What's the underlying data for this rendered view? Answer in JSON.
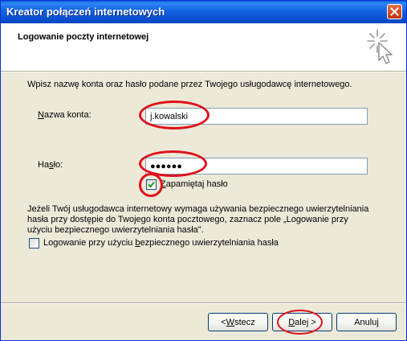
{
  "window": {
    "title": "Kreator połączeń internetowych"
  },
  "header": {
    "title": "Logowanie poczty internetowej",
    "icon": "wizard-wand-icon"
  },
  "form": {
    "intro": "Wpisz nazwę konta oraz hasło podane przez Twojego usługodawcę internetowego.",
    "account": {
      "label_pre": "",
      "label_key": "N",
      "label_post": "azwa konta:",
      "value": "j.kowalski"
    },
    "password": {
      "label_pre": "Ha",
      "label_key": "s",
      "label_post": "ło:",
      "value": "●●●●●●"
    },
    "remember": {
      "label_pre": "",
      "label_key": "Z",
      "label_post": "apamiętaj hasło",
      "checked": true
    },
    "description": [
      "Jeżeli Twój usługodawca internetowy wymaga używania bezpiecznego uwierzytelniania",
      "hasła przy dostępie do Twojego konta pocztowego, zaznacz pole „Logowanie przy",
      "użyciu bezpiecznego uwierzytelniania hasła\"."
    ],
    "secure": {
      "label_pre": "Logowanie przy użyciu ",
      "label_key": "b",
      "label_post": "ezpiecznego uwierzytelniania hasła",
      "checked": false
    }
  },
  "buttons": {
    "back": {
      "pre": "< ",
      "key": "W",
      "post": "stecz"
    },
    "next": {
      "pre": "",
      "key": "D",
      "post": "alej >"
    },
    "cancel": {
      "pre": "Anuluj",
      "key": "",
      "post": ""
    }
  },
  "colors": {
    "title_bar": "#0a5fd8",
    "dialog": "#ece9d8",
    "annotation": "#e0101a",
    "check": "#21a121"
  }
}
